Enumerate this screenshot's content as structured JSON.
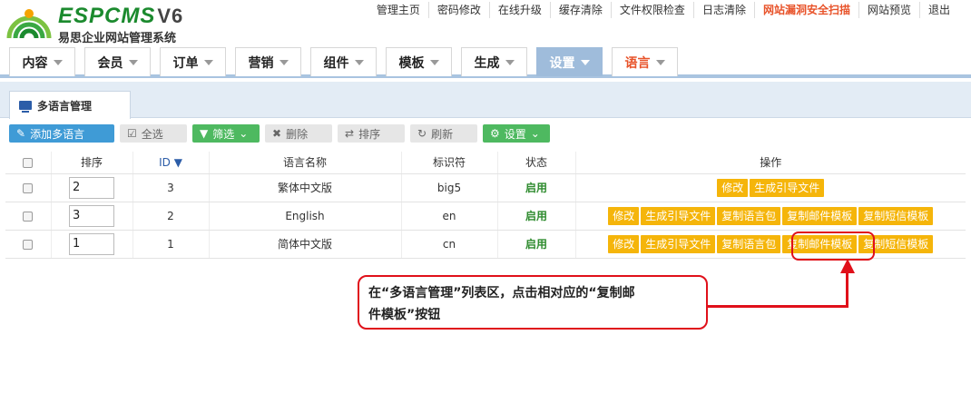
{
  "logo": {
    "brand": "ESPCMS",
    "version": "V6",
    "subtitle": "易思企业网站管理系统"
  },
  "topnav": [
    "管理主页",
    "密码修改",
    "在线升级",
    "缓存清除",
    "文件权限检查",
    "日志清除",
    "网站漏洞安全扫描",
    "网站预览",
    "退出"
  ],
  "menu": [
    "内容",
    "会员",
    "订单",
    "营销",
    "组件",
    "模板",
    "生成",
    "设置",
    "语言"
  ],
  "subtab": "多语言管理",
  "toolbar": {
    "add": "添加多语言",
    "select_all": "全选",
    "filter": "筛选",
    "delete": "删除",
    "sort": "排序",
    "refresh": "刷新",
    "settings": "设置"
  },
  "table": {
    "headers": {
      "sort": "排序",
      "id": "ID",
      "name": "语言名称",
      "code": "标识符",
      "status": "状态",
      "actions": "操作"
    },
    "rows": [
      {
        "sort": "2",
        "id": "3",
        "name": "繁体中文版",
        "code": "big5",
        "status": "启用",
        "actions": [
          "修改",
          "生成引导文件"
        ]
      },
      {
        "sort": "3",
        "id": "2",
        "name": "English",
        "code": "en",
        "status": "启用",
        "actions": [
          "修改",
          "生成引导文件",
          "复制语言包",
          "复制邮件模板",
          "复制短信模板"
        ]
      },
      {
        "sort": "1",
        "id": "1",
        "name": "简体中文版",
        "code": "cn",
        "status": "启用",
        "actions": [
          "修改",
          "生成引导文件",
          "复制语言包",
          "复制邮件模板",
          "复制短信模板"
        ]
      }
    ]
  },
  "callout": {
    "line1": "在“多语言管理”列表区，点击相对应的“复制邮",
    "line2": "件模板”按钮"
  },
  "colors": {
    "accent": "#f5b50a",
    "highlight": "#e0101a",
    "brand": "#1b8a2e"
  }
}
